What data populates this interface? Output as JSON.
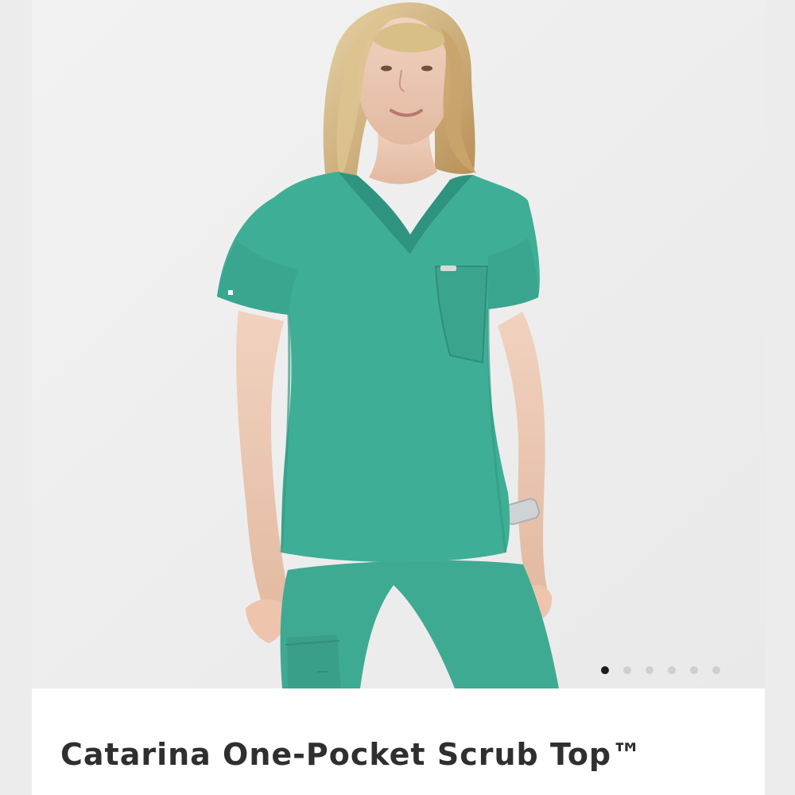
{
  "product": {
    "title": "Catarina One-Pocket Scrub Top™"
  },
  "gallery": {
    "image_count": 6,
    "active_index": 0,
    "image_alt": "Model wearing teal one-pocket scrub top and matching pants"
  },
  "colors": {
    "scrub": "#3fae96",
    "active_dot": "#1d1d1d",
    "inactive_dot": "#cfcfcf",
    "title_text": "#2f2f2f"
  }
}
